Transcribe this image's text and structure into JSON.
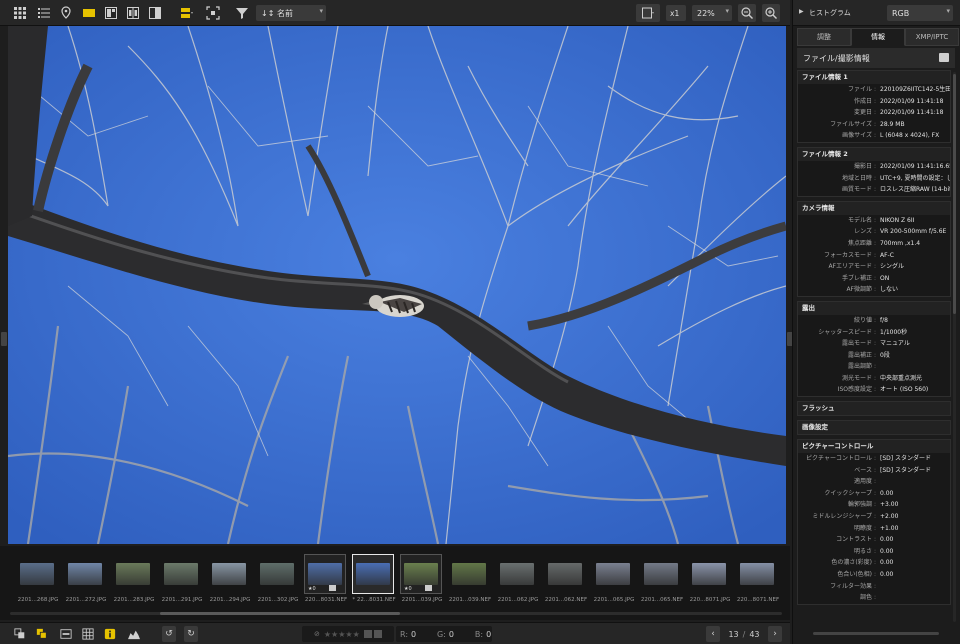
{
  "toolbar": {
    "sort_label": "↓↕ 名前",
    "scale_label": "x1",
    "zoom": "22%"
  },
  "filmstrip": {
    "items": [
      {
        "name": "2201...268.JPG",
        "color": "#5a6e8a"
      },
      {
        "name": "2201...272.JPG",
        "color": "#7086a8"
      },
      {
        "name": "2201...283.JPG",
        "color": "#6a7a5a"
      },
      {
        "name": "2201...291.JPG",
        "color": "#6b7a6a"
      },
      {
        "name": "2201...294.JPG",
        "color": "#8896a4"
      },
      {
        "name": "2201...302.JPG",
        "color": "#5f6e6a"
      },
      {
        "name": "220...8031.NEF",
        "color": "#4f6ea8",
        "mark": "★0",
        "badge": true
      },
      {
        "name": "* 22...8031.NEF",
        "color": "#4a6eb4"
      },
      {
        "name": "2201...039.JPG",
        "color": "#6a7f4e",
        "mark": "★0",
        "badge": true
      },
      {
        "name": "2201...039.NEF",
        "color": "#627748"
      },
      {
        "name": "2201...062.JPG",
        "color": "#6a7070"
      },
      {
        "name": "2201...062.NEF",
        "color": "#666a6a"
      },
      {
        "name": "2201...065.JPG",
        "color": "#7a8090"
      },
      {
        "name": "2201...065.NEF",
        "color": "#737a88"
      },
      {
        "name": "220...8071.JPG",
        "color": "#8a94aa"
      },
      {
        "name": "220...8071.NEF",
        "color": "#8590a6"
      }
    ]
  },
  "bottombar": {
    "r_label": "R:",
    "r_value": "0",
    "g_label": "G:",
    "g_value": "0",
    "b_label": "B:",
    "b_value": "0",
    "page_current": "13",
    "page_sep": "/",
    "page_total": "43"
  },
  "panel": {
    "histogram_label": "ヒストグラム",
    "channel": "RGB",
    "tabs": [
      {
        "label": "調整"
      },
      {
        "label": "情報"
      },
      {
        "label": "XMP/IPTC"
      }
    ],
    "title": "ファイル/撮影情報",
    "sections": [
      {
        "title": "ファイル情報 1",
        "rows": [
          {
            "k": "ファイル",
            "v": "220109Z6IITC142-5生田"
          },
          {
            "k": "作成日",
            "v": "2022/01/09 11:41:18"
          },
          {
            "k": "変更日",
            "v": "2022/01/09 11:41:18"
          },
          {
            "k": "ファイルサイズ",
            "v": "28.9 MB"
          },
          {
            "k": "画像サイズ",
            "v": "L (6048 x 4024), FX"
          }
        ]
      },
      {
        "title": "ファイル情報 2",
        "rows": [
          {
            "k": "撮影日",
            "v": "2022/01/09 11:41:16.65"
          },
          {
            "k": "地域と日時",
            "v": "UTC+9, 夏時間の設定：し"
          },
          {
            "k": "画質モード",
            "v": "ロスレス圧縮RAW (14-bit"
          }
        ]
      },
      {
        "title": "カメラ情報",
        "rows": [
          {
            "k": "モデル名",
            "v": "NIKON Z 6II"
          },
          {
            "k": "レンズ",
            "v": "VR 200-500mm f/5.6E"
          },
          {
            "k": "焦点距離",
            "v": "700mm ,x1.4"
          },
          {
            "k": "フォーカスモード",
            "v": "AF-C"
          },
          {
            "k": "AFエリアモード",
            "v": "シングル"
          },
          {
            "k": "手ブレ補正",
            "v": "ON"
          },
          {
            "k": "AF微調節",
            "v": "しない"
          }
        ]
      },
      {
        "title": "露出",
        "rows": [
          {
            "k": "絞り値",
            "v": "f/8"
          },
          {
            "k": "シャッタースピード",
            "v": "1/1000秒"
          },
          {
            "k": "露出モード",
            "v": "マニュアル"
          },
          {
            "k": "露出補正",
            "v": "0段"
          },
          {
            "k": "露出調節",
            "v": ""
          },
          {
            "k": "測光モード",
            "v": "中央部重点測光"
          },
          {
            "k": "ISO感度設定",
            "v": "オート (ISO 560)"
          }
        ]
      },
      {
        "title": "フラッシュ",
        "rows": []
      },
      {
        "title": "画像設定",
        "rows": []
      },
      {
        "title": "ピクチャーコントロール",
        "rows": [
          {
            "k": "ピクチャーコントロール",
            "v": "[SD] スタンダード"
          },
          {
            "k": "ベース",
            "v": "[SD] スタンダード"
          },
          {
            "k": "適用度",
            "v": ""
          },
          {
            "k": "クイックシャープ",
            "v": "0.00"
          },
          {
            "k": "輪郭強調",
            "v": "+3.00"
          },
          {
            "k": "ミドルレンジシャープ",
            "v": "+2.00"
          },
          {
            "k": "明瞭度",
            "v": "+1.00"
          },
          {
            "k": "コントラスト",
            "v": "0.00"
          },
          {
            "k": "明るさ",
            "v": "0.00"
          },
          {
            "k": "色の濃さ(彩度)",
            "v": "0.00"
          },
          {
            "k": "色合い(色相)",
            "v": "0.00"
          },
          {
            "k": "フィルター効果",
            "v": ""
          },
          {
            "k": "調色",
            "v": ""
          }
        ]
      }
    ]
  },
  "colors": {
    "sky": "#3a6fd1",
    "accent_yellow": "#e6c200"
  }
}
